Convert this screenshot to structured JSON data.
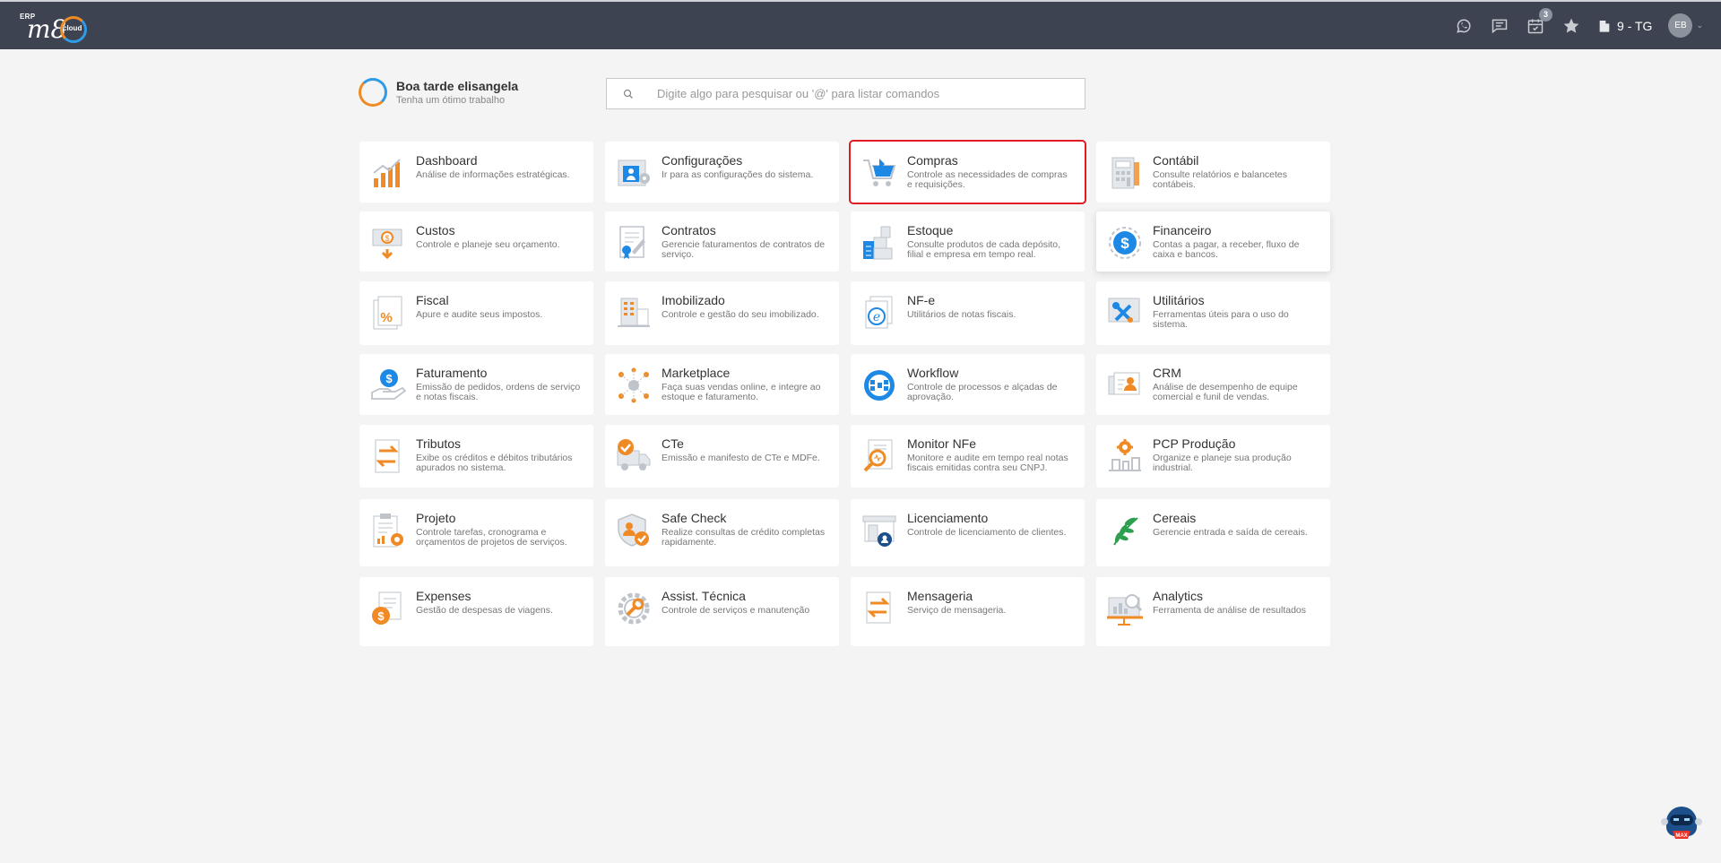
{
  "topbar": {
    "logo_erp": "ERP",
    "logo_m8": "m8",
    "logo_cloud": "cloud",
    "icons": [
      "whatsapp-icon",
      "chat-icon",
      "calendar-icon",
      "star-icon"
    ],
    "calendar_badge": "3",
    "company": "9 - TG",
    "avatar_initials": "EB"
  },
  "greeting": {
    "title": "Boa tarde elisangela",
    "subtitle": "Tenha um ótimo trabalho"
  },
  "search": {
    "placeholder": "Digite algo para pesquisar ou '@' para listar comandos"
  },
  "colors": {
    "orange": "#f08a24",
    "blue": "#1e88e5",
    "green": "#2e9e4f",
    "selected_border": "#e01b24",
    "topbar": "#3d4350"
  },
  "modules": [
    {
      "title": "Dashboard",
      "desc": "Análise de informações estratégicas.",
      "icon": "bar-chart-icon"
    },
    {
      "title": "Configurações",
      "desc": "Ir para as configurações do sistema.",
      "icon": "settings-icon"
    },
    {
      "title": "Compras",
      "desc": "Controle as necessidades de compras e requisições.",
      "icon": "shopping-cart-icon",
      "selected": true
    },
    {
      "title": "Contábil",
      "desc": "Consulte relatórios e balancetes contábeis.",
      "icon": "calculator-icon"
    },
    {
      "title": "Custos",
      "desc": "Controle e planeje seu orçamento.",
      "icon": "money-icon"
    },
    {
      "title": "Contratos",
      "desc": "Gerencie faturamentos de contratos de serviço.",
      "icon": "contract-icon"
    },
    {
      "title": "Estoque",
      "desc": "Consulte produtos de cada depósito, filial e empresa em tempo real.",
      "icon": "boxes-icon"
    },
    {
      "title": "Financeiro",
      "desc": "Contas a pagar, a receber, fluxo de caixa e bancos.",
      "icon": "dollar-icon",
      "hover": true
    },
    {
      "title": "Fiscal",
      "desc": "Apure e audite seus impostos.",
      "icon": "percent-icon"
    },
    {
      "title": "Imobilizado",
      "desc": "Controle e gestão do seu imobilizado.",
      "icon": "building-icon"
    },
    {
      "title": "NF-e",
      "desc": "Utilitários de notas fiscais.",
      "icon": "nfe-icon"
    },
    {
      "title": "Utilitários",
      "desc": "Ferramentas úteis para o uso do sistema.",
      "icon": "tools-icon"
    },
    {
      "title": "Faturamento",
      "desc": "Emissão de pedidos, ordens de serviço e notas fiscais.",
      "icon": "hand-dollar-icon"
    },
    {
      "title": "Marketplace",
      "desc": "Faça suas vendas online, e integre ao estoque e faturamento.",
      "icon": "network-icon"
    },
    {
      "title": "Workflow",
      "desc": "Controle de processos e alçadas de aprovação.",
      "icon": "workflow-icon"
    },
    {
      "title": "CRM",
      "desc": "Análise de desempenho de equipe comercial e funil de vendas.",
      "icon": "crm-icon"
    },
    {
      "title": "Tributos",
      "desc": "Exibe os créditos e débitos tributários apurados no sistema.",
      "icon": "transfer-icon"
    },
    {
      "title": "CTe",
      "desc": "Emissão e manifesto de CTe e MDFe.",
      "icon": "truck-icon"
    },
    {
      "title": "Monitor NFe",
      "desc": "Monitore e audite em tempo real notas fiscais emitidas contra seu CNPJ.",
      "icon": "magnifier-doc-icon"
    },
    {
      "title": "PCP Produção",
      "desc": "Organize e planeje sua produção industrial.",
      "icon": "factory-gear-icon"
    },
    {
      "title": "Projeto",
      "desc": "Controle tarefas, cronograma e orçamentos de projetos de serviços.",
      "icon": "clipboard-gear-icon"
    },
    {
      "title": "Safe Check",
      "desc": "Realize consultas de crédito completas rapidamente.",
      "icon": "shield-check-icon"
    },
    {
      "title": "Licenciamento",
      "desc": "Controle de licenciamento de clientes.",
      "icon": "license-icon"
    },
    {
      "title": "Cereais",
      "desc": "Gerencie entrada e saída de cereais.",
      "icon": "leaf-icon"
    },
    {
      "title": "Expenses",
      "desc": "Gestão de despesas de viagens.",
      "icon": "expense-icon"
    },
    {
      "title": "Assist. Técnica",
      "desc": "Controle de serviços e manutenção",
      "icon": "wrench-gear-icon"
    },
    {
      "title": "Mensageria",
      "desc": "Serviço de mensageria.",
      "icon": "message-transfer-icon"
    },
    {
      "title": "Analytics",
      "desc": "Ferramenta de análise de resultados",
      "icon": "analytics-icon"
    }
  ],
  "assistant": {
    "label": "MAX",
    "icon": "robot-icon"
  }
}
